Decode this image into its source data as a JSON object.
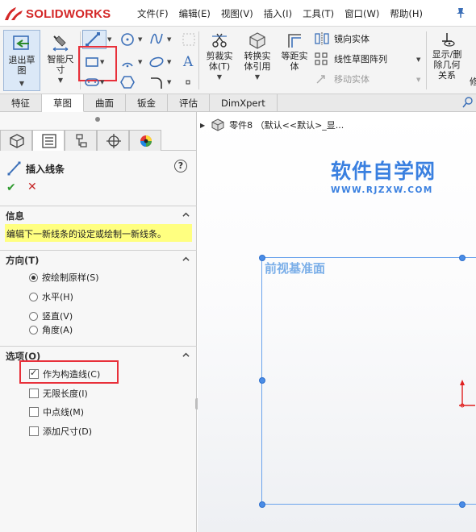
{
  "app": {
    "logo_text_1": "SOLID",
    "logo_text_2": "WORKS",
    "menus": [
      "文件(F)",
      "编辑(E)",
      "视图(V)",
      "插入(I)",
      "工具(T)",
      "窗口(W)",
      "帮助(H)"
    ]
  },
  "toolbar": {
    "exit_sketch_label": "退出草\n图",
    "smart_dim_label": "智能尺\n寸",
    "trim_label": "剪裁实\n体(T)",
    "convert_label": "转换实\n体引用",
    "offset_label": "等距实\n体",
    "mirror_label": "镜向实体",
    "linear_pattern_label": "线性草图阵列",
    "move_label": "移动实体",
    "show_relations_label": "显示/删\n除几何\n关系",
    "overflow_label": "修"
  },
  "tabs": [
    "特征",
    "草图",
    "曲面",
    "钣金",
    "评估",
    "DimXpert"
  ],
  "active_tab": "草图",
  "panel": {
    "title": "插入线条",
    "help_label": "?",
    "ok_label": "✔",
    "cancel_label": "✕",
    "sections": {
      "info": {
        "title": "信息",
        "message": "编辑下一新线条的设定或绘制一新线条。"
      },
      "direction": {
        "title": "方向(T)",
        "options": [
          "按绘制原样(S)",
          "水平(H)",
          "竖直(V)",
          "角度(A)"
        ],
        "selected": "按绘制原样(S)"
      },
      "options": {
        "title": "选项(O)",
        "items": [
          {
            "label": "作为构造线(C)",
            "checked": true
          },
          {
            "label": "无限长度(I)",
            "checked": false
          },
          {
            "label": "中点线(M)",
            "checked": false
          },
          {
            "label": "添加尺寸(D)",
            "checked": false
          }
        ]
      }
    }
  },
  "graphics": {
    "tree_item": "零件8 （默认<<默认>_显...",
    "watermark_title": "软件自学网",
    "watermark_url": "WWW.RJZXW.COM",
    "plane_label": "前视基准面"
  },
  "colors": {
    "highlight": "#e8303a",
    "plane": "#6aa3ec",
    "watermark": "#3a80e0",
    "info_bg": "#ffff80",
    "ok": "#2f9a2f",
    "cancel": "#c62828"
  }
}
